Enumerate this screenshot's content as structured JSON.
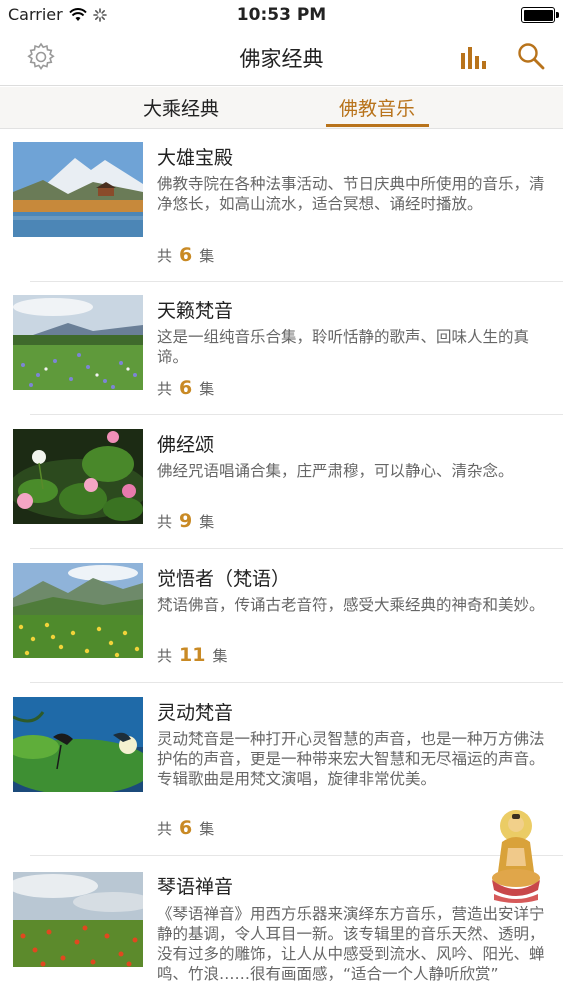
{
  "status_bar": {
    "carrier": "Carrier",
    "time": "10:53 PM"
  },
  "nav": {
    "title": "佛家经典",
    "settings_icon": "gear-icon",
    "chart_icon": "bar-chart-icon",
    "search_icon": "search-icon",
    "accent": "#b8731b"
  },
  "tabs": [
    {
      "label": "大乘经典"
    },
    {
      "label": "佛教音乐"
    }
  ],
  "items": [
    {
      "title": "大雄宝殿",
      "desc": "佛教寺院在各种法事活动、节日庆典中所使用的音乐，清净悠长，如高山流水，适合冥想、诵经时播放。",
      "count_prefix": "共",
      "count": "6",
      "count_suffix": "集"
    },
    {
      "title": "天籁梵音",
      "desc": "这是一组纯音乐合集，聆听恬静的歌声、回味人生的真谛。",
      "count_prefix": "共",
      "count": "6",
      "count_suffix": "集"
    },
    {
      "title": "佛经颂",
      "desc": "佛经咒语唱诵合集，庄严肃穆，可以静心、清杂念。",
      "count_prefix": "共",
      "count": "9",
      "count_suffix": "集"
    },
    {
      "title": "觉悟者（梵语）",
      "desc": "梵语佛音，传诵古老音符，感受大乘经典的神奇和美妙。",
      "count_prefix": "共",
      "count": "11",
      "count_suffix": "集"
    },
    {
      "title": "灵动梵音",
      "desc": "灵动梵音是一种打开心灵智慧的声音，也是一种万方佛法护佑的声音，更是一种带来宏大智慧和无尽福运的声音。专辑歌曲是用梵文演唱，旋律非常优美。",
      "count_prefix": "共",
      "count": "6",
      "count_suffix": "集"
    },
    {
      "title": "琴语禅音",
      "desc": "《琴语禅音》用西方乐器来演绎东方音乐，营造出安详宁静的基调，令人耳目一新。该专辑里的音乐天然、透明，没有过多的雕饰，让人从中感受到流水、风吟、阳光、蝉鸣、竹浪……很有画面感，“适合一个人静听欣赏”",
      "count_prefix": "",
      "count": "",
      "count_suffix": ""
    }
  ]
}
